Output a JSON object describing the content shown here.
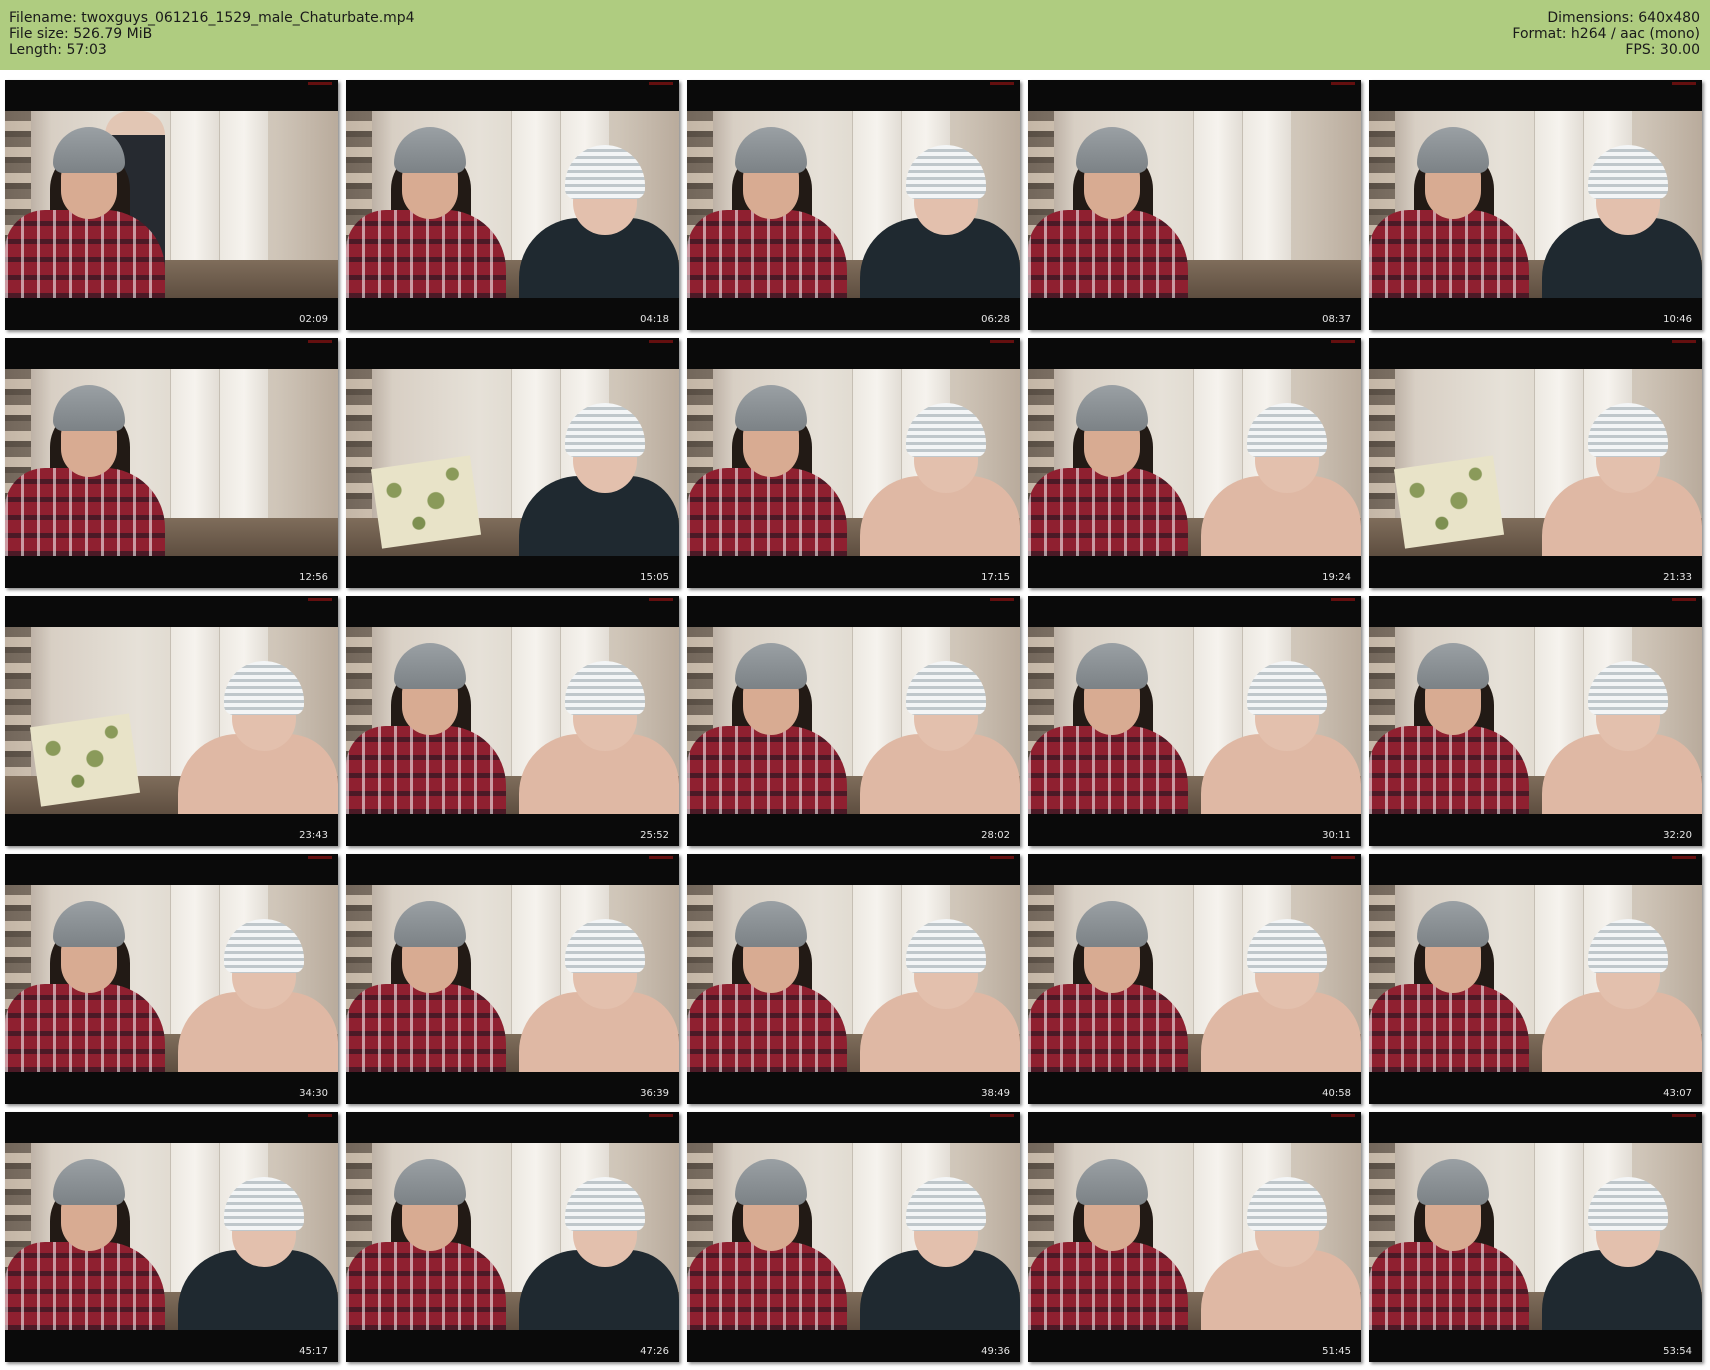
{
  "header": {
    "filename": "Filename: twoxguys_061216_1529_male_Chaturbate.mp4",
    "filesize": "File size: 526.79 MiB",
    "length": "Length: 57:03",
    "dimensions": "Dimensions: 640x480",
    "format": "Format: h264 / aac (mono)",
    "fps": "FPS: 30.00"
  },
  "colors": {
    "header_bg": "#afcc80",
    "frame_bg": "#0a0a0a",
    "timestamp_text": "#e6e6e6"
  },
  "thumbnails": [
    {
      "time": "02:09",
      "scene": "standing"
    },
    {
      "time": "04:18",
      "scene": "both-hoodie"
    },
    {
      "time": "06:28",
      "scene": "both-hoodie"
    },
    {
      "time": "08:37",
      "scene": "left-only"
    },
    {
      "time": "10:46",
      "scene": "both-hoodie"
    },
    {
      "time": "12:56",
      "scene": "left-only"
    },
    {
      "time": "15:05",
      "scene": "pillow-hoodie"
    },
    {
      "time": "17:15",
      "scene": "both-bare"
    },
    {
      "time": "19:24",
      "scene": "both-bare"
    },
    {
      "time": "21:33",
      "scene": "pillow-bare"
    },
    {
      "time": "23:43",
      "scene": "pillow-bare"
    },
    {
      "time": "25:52",
      "scene": "both-bare"
    },
    {
      "time": "28:02",
      "scene": "both-bare"
    },
    {
      "time": "30:11",
      "scene": "both-bare"
    },
    {
      "time": "32:20",
      "scene": "both-bare"
    },
    {
      "time": "34:30",
      "scene": "both-bare"
    },
    {
      "time": "36:39",
      "scene": "both-bare"
    },
    {
      "time": "38:49",
      "scene": "both-bare"
    },
    {
      "time": "40:58",
      "scene": "both-bare"
    },
    {
      "time": "43:07",
      "scene": "both-bare"
    },
    {
      "time": "45:17",
      "scene": "both-hoodie"
    },
    {
      "time": "47:26",
      "scene": "both-hoodie"
    },
    {
      "time": "49:36",
      "scene": "both-hoodie"
    },
    {
      "time": "51:45",
      "scene": "both-bare"
    },
    {
      "time": "53:54",
      "scene": "both-hoodie"
    }
  ]
}
